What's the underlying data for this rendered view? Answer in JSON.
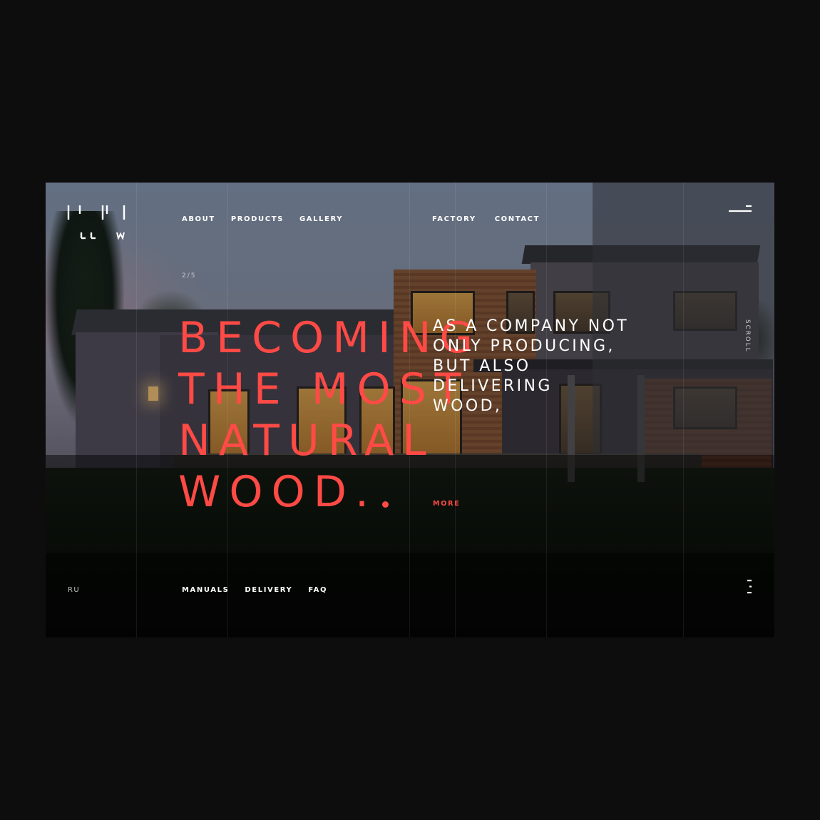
{
  "brand": {
    "logo_icon": "llw-logo-icon"
  },
  "nav": {
    "left": [
      "ABOUT",
      "PRODUCTS",
      "GALLERY"
    ],
    "right": [
      "FACTORY",
      "CONTACT"
    ]
  },
  "menu_icon": "hamburger-icon",
  "hero": {
    "counter": "2/5",
    "headline": [
      "BECOMING",
      "THE MOST",
      "NATURAL",
      "WOOD."
    ],
    "subheadline": [
      "AS A COMPANY NOT",
      "ONLY PRODUCING,",
      "BUT ALSO",
      "DELIVERING",
      "WOOD,"
    ],
    "more_label": "MORE",
    "scroll_label": "SCROLL"
  },
  "footer": {
    "language": "RU",
    "links": [
      "MANUALS",
      "DELIVERY",
      "FAQ"
    ],
    "more_icon": "vertical-dots-icon"
  },
  "colors": {
    "accent": "#ff4a45",
    "background": "#0d0d0d",
    "text": "#ffffff"
  }
}
